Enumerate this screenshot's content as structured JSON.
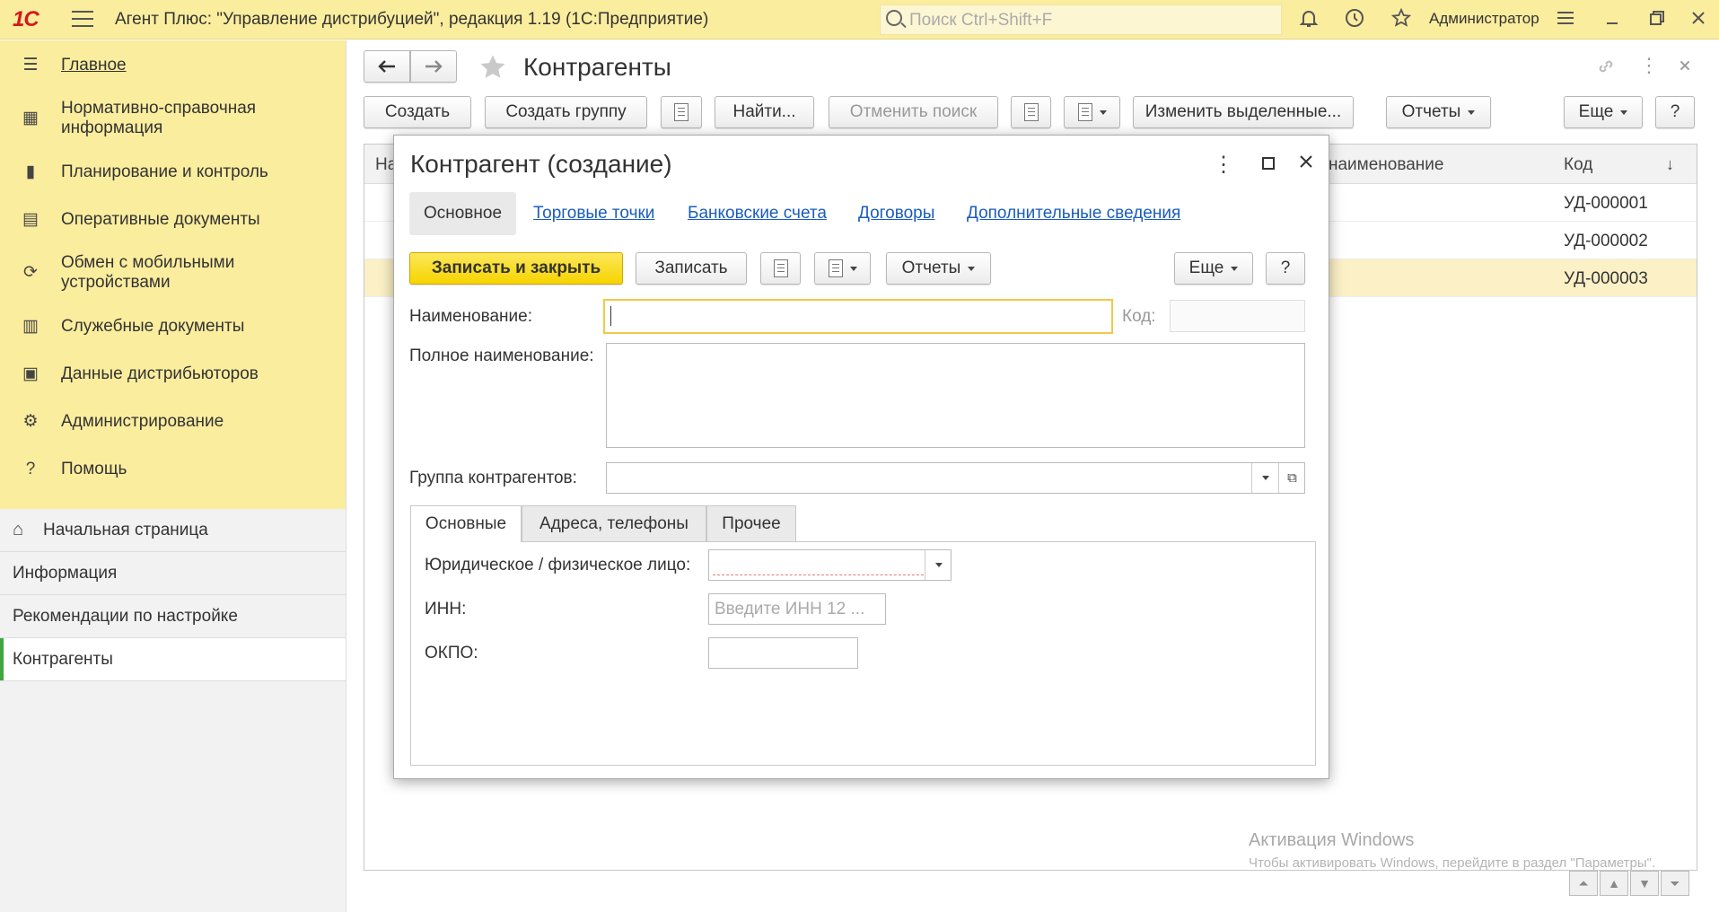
{
  "topbar": {
    "logo": "1С",
    "title": "Агент Плюс: \"Управление дистрибуцией\", редакция 1.19  (1С:Предприятие)",
    "search_placeholder": "Поиск Ctrl+Shift+F",
    "user": "Администратор"
  },
  "sidebar": {
    "sections": [
      {
        "label": "Главное",
        "icon": "menu-lines-icon"
      },
      {
        "label": "Нормативно-справочная\nинформация",
        "icon": "grid-icon"
      },
      {
        "label": "Планирование и контроль",
        "icon": "bar-chart-icon"
      },
      {
        "label": "Оперативные документы",
        "icon": "documents-icon"
      },
      {
        "label": "Обмен с мобильными\nустройствами",
        "icon": "sync-icon"
      },
      {
        "label": "Служебные документы",
        "icon": "service-docs-icon"
      },
      {
        "label": "Данные дистрибьюторов",
        "icon": "distributor-icon"
      },
      {
        "label": "Администрирование",
        "icon": "gear-icon"
      },
      {
        "label": "Помощь",
        "icon": "question-icon"
      }
    ],
    "nav": [
      {
        "label": "Начальная страница",
        "icon": "home-icon"
      },
      {
        "label": "Информация"
      },
      {
        "label": "Рекомендации по настройке"
      },
      {
        "label": "Контрагенты",
        "active": true
      }
    ]
  },
  "list": {
    "title": "Контрагенты",
    "toolbar": {
      "create": "Создать",
      "create_group": "Создать группу",
      "find": "Найти...",
      "cancel_search": "Отменить поиск",
      "change_selected": "Изменить выделенные...",
      "reports": "Отчеты",
      "more": "Еще",
      "help": "?"
    },
    "columns": [
      "На",
      "наименование",
      "Код"
    ],
    "rows": [
      {
        "code": "УД-000001"
      },
      {
        "code": "УД-000002"
      },
      {
        "code": "УД-000003",
        "selected": true
      }
    ]
  },
  "dialog": {
    "title": "Контрагент (создание)",
    "tabs": [
      "Основное",
      "Торговые точки",
      "Банковские счета",
      "Договоры",
      "Дополнительные сведения"
    ],
    "toolbar": {
      "save_close": "Записать и закрыть",
      "save": "Записать",
      "reports": "Отчеты",
      "more": "Еще",
      "help": "?"
    },
    "fields": {
      "name_label": "Наименование:",
      "name_value": "",
      "code_label": "Код:",
      "full_name_label": "Полное наименование:",
      "group_label": "Группа контрагентов:"
    },
    "inner_tabs": [
      "Основные",
      "Адреса, телефоны",
      "Прочее"
    ],
    "inner_fields": {
      "entity_type_label": "Юридическое / физическое лицо:",
      "inn_label": "ИНН:",
      "inn_placeholder": "Введите ИНН 12 ...",
      "okpo_label": "ОКПО:"
    }
  },
  "watermark": {
    "line1": "Активация Windows",
    "line2": "Чтобы активировать Windows, перейдите в раздел \"Параметры\"."
  },
  "colors": {
    "topbar": "#fbed9e",
    "accent_yellow": "#f6d400",
    "link": "#1a5dbb",
    "active_marker": "#3fa73f"
  }
}
